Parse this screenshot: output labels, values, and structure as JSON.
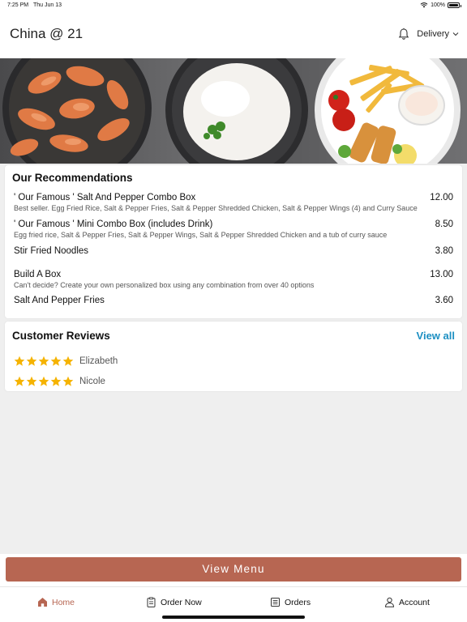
{
  "status_bar": {
    "time": "7:25 PM",
    "date": "Thu Jun 13",
    "battery": "100%"
  },
  "header": {
    "title": "China @ 21",
    "delivery_label": "Delivery"
  },
  "recommendations": {
    "title": "Our Recommendations",
    "items": [
      {
        "name": "' Our Famous ' Salt And Pepper Combo Box",
        "price": "12.00",
        "description": "Best seller. Egg Fried Rice, Salt & Pepper Fries, Salt & Pepper Shredded  Chicken, Salt & Pepper Wings (4) and Curry Sauce"
      },
      {
        "name": "' Our Famous ' Mini Combo Box (includes Drink)",
        "price": "8.50",
        "description": "Egg fried rice, Salt & Pepper Fries, Salt & Pepper Wings, Salt & Pepper Shredded Chicken and a tub of curry sauce"
      },
      {
        "name": "Stir Fried Noodles",
        "price": "3.80",
        "description": ""
      },
      {
        "name": "Build A Box",
        "price": "13.00",
        "description": "Can't decide? Create your own personalized box using any combination from over 40 options"
      },
      {
        "name": "Salt And Pepper Fries",
        "price": "3.60",
        "description": ""
      }
    ]
  },
  "reviews": {
    "title": "Customer Reviews",
    "view_all_label": "View all",
    "items": [
      {
        "name": "Elizabeth",
        "rating": 5
      },
      {
        "name": "Nicole",
        "rating": 5
      }
    ]
  },
  "view_menu_label": "View Menu",
  "tabs": [
    {
      "label": "Home",
      "icon": "home-icon",
      "active": true
    },
    {
      "label": "Order Now",
      "icon": "clipboard-icon",
      "active": false
    },
    {
      "label": "Orders",
      "icon": "receipt-icon",
      "active": false
    },
    {
      "label": "Account",
      "icon": "person-icon",
      "active": false
    }
  ],
  "colors": {
    "accent": "#b76652",
    "link": "#1c8fc2",
    "star": "#f5b301"
  }
}
